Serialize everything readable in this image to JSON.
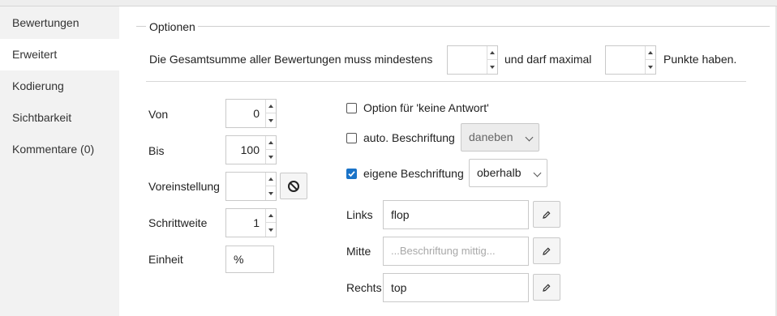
{
  "sidebar": {
    "items": [
      {
        "label": "Bewertungen",
        "active": false
      },
      {
        "label": "Erweitert",
        "active": true
      },
      {
        "label": "Kodierung",
        "active": false
      },
      {
        "label": "Sichtbarkeit",
        "active": false
      },
      {
        "label": "Kommentare (0)",
        "active": false
      }
    ]
  },
  "options": {
    "legend": "Optionen",
    "sum_text_1": "Die Gesamtsumme aller Bewertungen muss mindestens",
    "sum_min_value": "",
    "sum_text_2": "und darf maximal",
    "sum_max_value": "",
    "sum_text_3": "Punkte haben."
  },
  "range": {
    "von_label": "Von",
    "von_value": "0",
    "bis_label": "Bis",
    "bis_value": "100",
    "voreinstellung_label": "Voreinstellung",
    "voreinstellung_value": "",
    "schrittweite_label": "Schrittweite",
    "schrittweite_value": "1",
    "einheit_label": "Einheit",
    "einheit_value": "%"
  },
  "checkboxes": {
    "keine_antwort_label": "Option für 'keine Antwort'",
    "keine_antwort_checked": false,
    "auto_label": "auto. Beschriftung",
    "auto_checked": false,
    "auto_select": "daneben",
    "eigene_label": "eigene Beschriftung",
    "eigene_checked": true,
    "eigene_select": "oberhalb"
  },
  "labels": {
    "links_label": "Links",
    "links_value": "flop",
    "mitte_label": "Mitte",
    "mitte_placeholder": "...Beschriftung mittig...",
    "rechts_label": "Rechts",
    "rechts_value": "top"
  },
  "colors": {
    "checkbox_checked": "#1a73c8",
    "sidebar_bg": "#f2f2f2"
  },
  "icons": {
    "reset": "ban-icon",
    "edit": "pencil-icon"
  }
}
